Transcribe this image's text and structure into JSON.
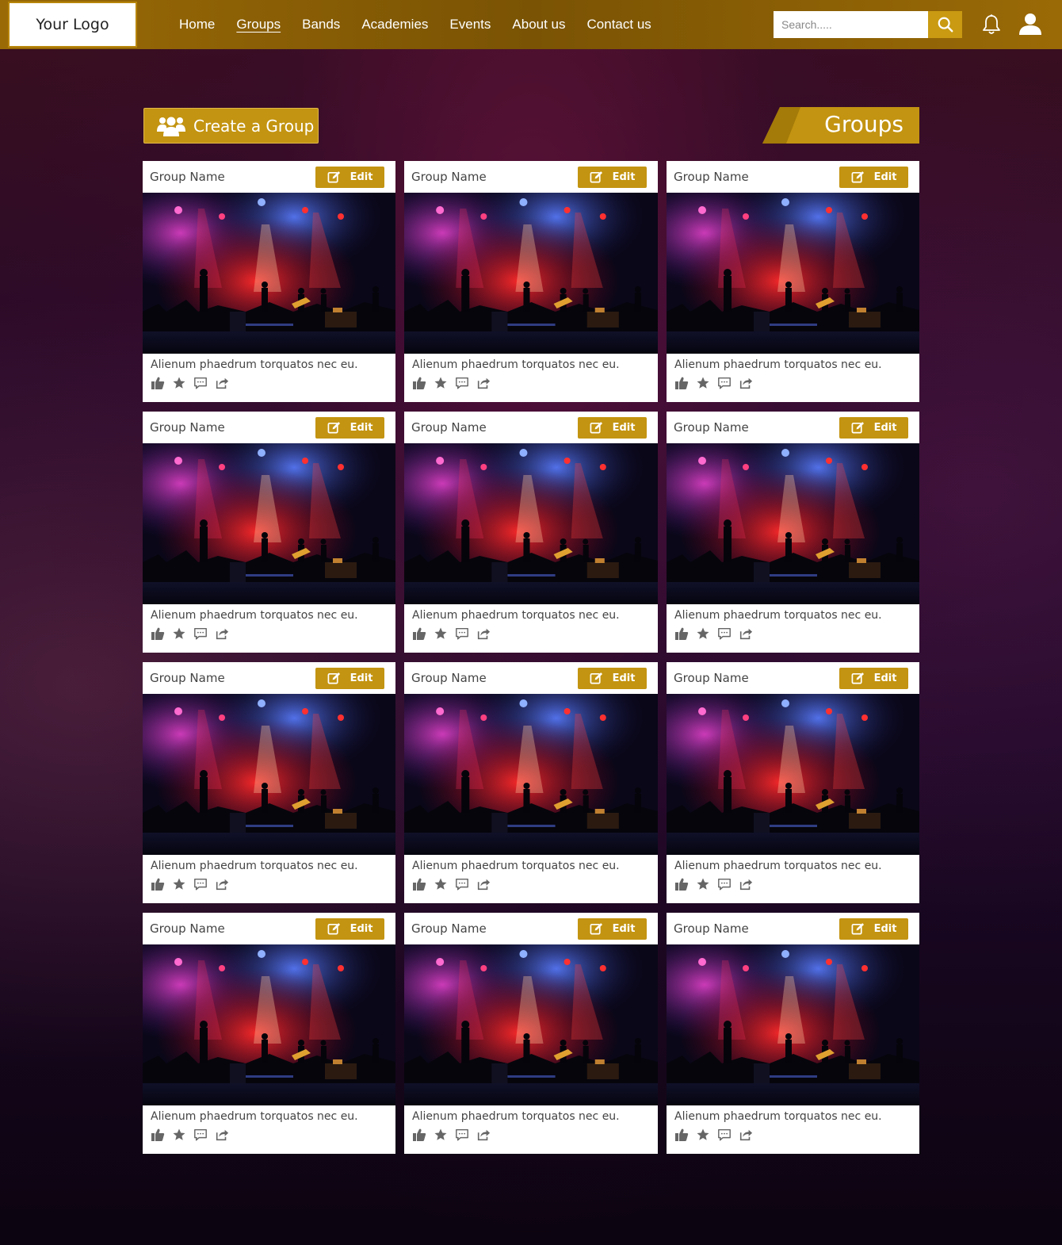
{
  "header": {
    "logo": "Your Logo",
    "nav": [
      {
        "label": "Home",
        "active": false
      },
      {
        "label": "Groups",
        "active": true
      },
      {
        "label": "Bands",
        "active": false
      },
      {
        "label": "Academies",
        "active": false
      },
      {
        "label": "Events",
        "active": false
      },
      {
        "label": "About us",
        "active": false
      },
      {
        "label": "Contact us",
        "active": false
      }
    ],
    "search_placeholder": "Search.....",
    "icons": [
      "search-icon",
      "bell-icon",
      "user-icon"
    ]
  },
  "toolbar": {
    "create_label": "Create a Group",
    "page_title": "Groups"
  },
  "colors": {
    "accent": "#c39411",
    "header": "#8a5e05"
  },
  "cards": [
    {
      "title": "Group Name",
      "edit_label": "Edit",
      "description": "Alienum phaedrum torquatos nec eu."
    },
    {
      "title": "Group Name",
      "edit_label": "Edit",
      "description": "Alienum phaedrum torquatos nec eu."
    },
    {
      "title": "Group Name",
      "edit_label": "Edit",
      "description": "Alienum phaedrum torquatos nec eu."
    },
    {
      "title": "Group Name",
      "edit_label": "Edit",
      "description": "Alienum phaedrum torquatos nec eu."
    },
    {
      "title": "Group Name",
      "edit_label": "Edit",
      "description": "Alienum phaedrum torquatos nec eu."
    },
    {
      "title": "Group Name",
      "edit_label": "Edit",
      "description": "Alienum phaedrum torquatos nec eu."
    },
    {
      "title": "Group Name",
      "edit_label": "Edit",
      "description": "Alienum phaedrum torquatos nec eu."
    },
    {
      "title": "Group Name",
      "edit_label": "Edit",
      "description": "Alienum phaedrum torquatos nec eu."
    },
    {
      "title": "Group Name",
      "edit_label": "Edit",
      "description": "Alienum phaedrum torquatos nec eu."
    },
    {
      "title": "Group Name",
      "edit_label": "Edit",
      "description": "Alienum phaedrum torquatos nec eu."
    },
    {
      "title": "Group Name",
      "edit_label": "Edit",
      "description": "Alienum phaedrum torquatos nec eu."
    },
    {
      "title": "Group Name",
      "edit_label": "Edit",
      "description": "Alienum phaedrum torquatos nec eu."
    }
  ]
}
